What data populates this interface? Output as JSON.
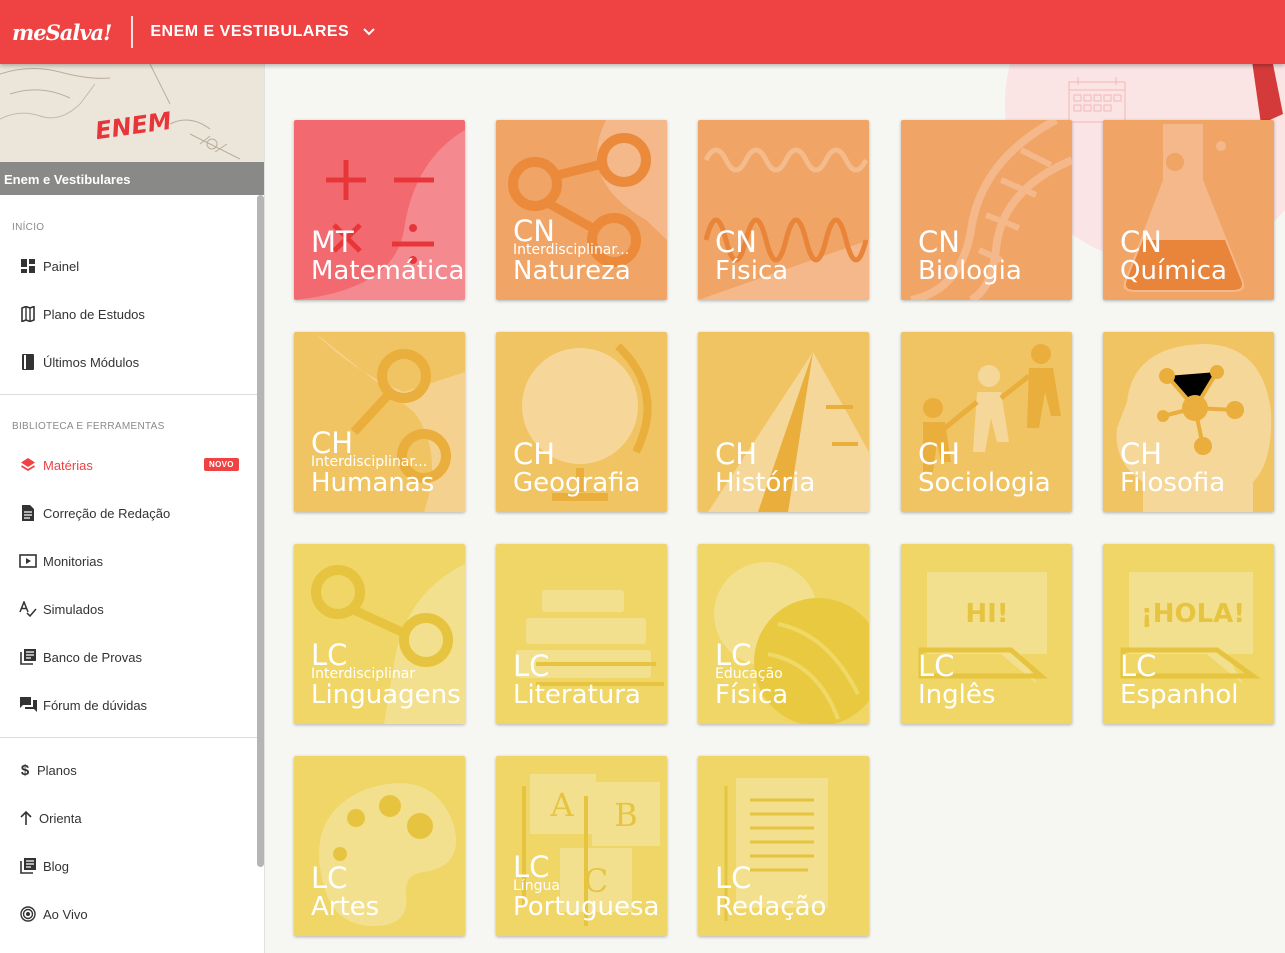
{
  "header": {
    "logo": "meSalva!",
    "section": "ENEM E VESTIBULARES"
  },
  "sidebar": {
    "banner": {
      "title": "ENEM",
      "caption": "Enem e Vestibulares"
    },
    "sections": {
      "inicio": "INÍCIO",
      "biblioteca": "BIBLIOTECA E FERRAMENTAS"
    },
    "items": {
      "painel": "Painel",
      "plano": "Plano de Estudos",
      "ultimos": "Últimos Módulos",
      "materias": "Matérias",
      "materias_badge": "NOVO",
      "correcao": "Correção de Redação",
      "monitorias": "Monitorias",
      "simulados": "Simulados",
      "banco": "Banco de Provas",
      "forum": "Fórum de dúvidas",
      "planos": "Planos",
      "orienta": "Orienta",
      "blog": "Blog",
      "aovivo": "Ao Vivo"
    }
  },
  "tiles": [
    {
      "code": "MT",
      "sub": "",
      "name": "Matemática",
      "color": "#f26a70"
    },
    {
      "code": "CN",
      "sub": "Interdisciplinar...",
      "name": "Natureza",
      "color": "#f0a465"
    },
    {
      "code": "CN",
      "sub": "",
      "name": "Física",
      "color": "#f0a465"
    },
    {
      "code": "CN",
      "sub": "",
      "name": "Biologia",
      "color": "#f0a465"
    },
    {
      "code": "CN",
      "sub": "",
      "name": "Química",
      "color": "#f0a465"
    },
    {
      "code": "CH",
      "sub": "Interdisciplinar...",
      "name": "Humanas",
      "color": "#f1c463"
    },
    {
      "code": "CH",
      "sub": "",
      "name": "Geografia",
      "color": "#f1c463"
    },
    {
      "code": "CH",
      "sub": "",
      "name": "História",
      "color": "#f1c463"
    },
    {
      "code": "CH",
      "sub": "",
      "name": "Sociologia",
      "color": "#f1c463"
    },
    {
      "code": "CH",
      "sub": "",
      "name": "Filosofia",
      "color": "#f1c463"
    },
    {
      "code": "LC",
      "sub": "Interdisciplinar",
      "name": "Linguagens",
      "color": "#efd667"
    },
    {
      "code": "LC",
      "sub": "",
      "name": "Literatura",
      "color": "#efd667"
    },
    {
      "code": "LC",
      "sub": "Educação",
      "name": "Física",
      "color": "#efd667"
    },
    {
      "code": "LC",
      "sub": "",
      "name": "Inglês",
      "color": "#efd667",
      "art_text": "HI!"
    },
    {
      "code": "LC",
      "sub": "",
      "name": "Espanhol",
      "color": "#efd667",
      "art_text": "¡HOLA!"
    },
    {
      "code": "LC",
      "sub": "",
      "name": "Artes",
      "color": "#efd667"
    },
    {
      "code": "LC",
      "sub": "Língua",
      "name": "Portuguesa",
      "color": "#efd667",
      "art_letters": [
        "A",
        "B",
        "C"
      ]
    },
    {
      "code": "LC",
      "sub": "",
      "name": "Redação",
      "color": "#efd667"
    }
  ]
}
